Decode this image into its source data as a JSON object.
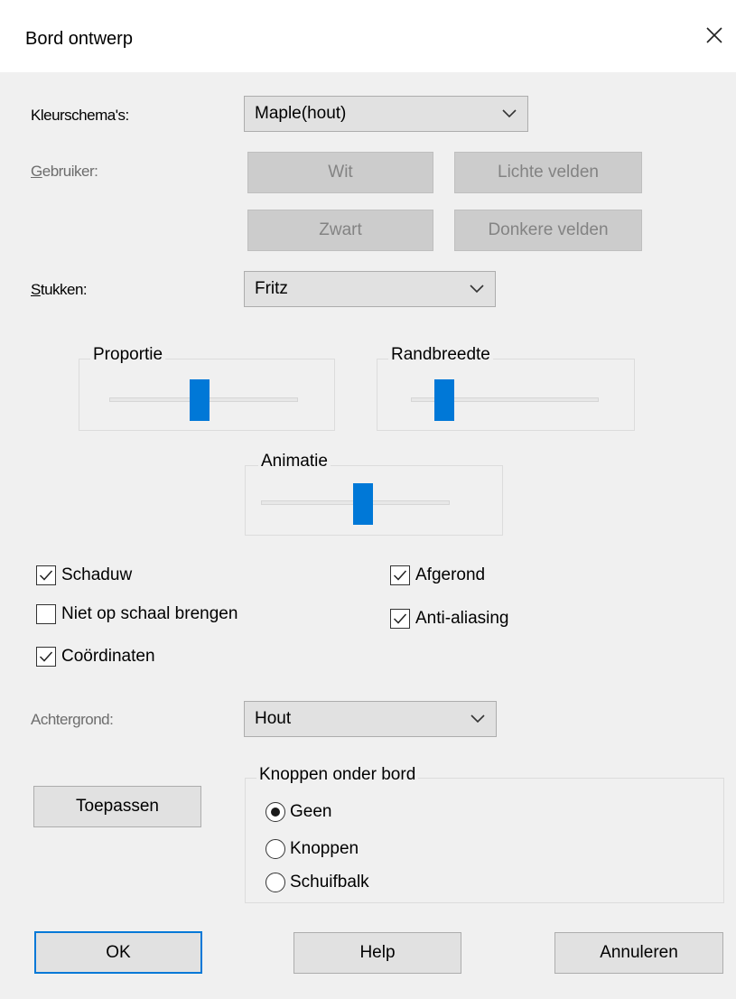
{
  "window": {
    "title": "Bord ontwerp"
  },
  "labels": {
    "color_schemes": "Kleurschema's:",
    "user_prefix": "G",
    "user_rest": "ebruiker:",
    "pieces_prefix": "S",
    "pieces_rest": "tukken:",
    "background": "Achtergrond:"
  },
  "combos": {
    "color_scheme": "Maple(hout)",
    "pieces": "Fritz",
    "background": "Hout"
  },
  "user_buttons": {
    "white": "Wit",
    "light_squares": "Lichte velden",
    "black": "Zwart",
    "dark_squares": "Donkere velden"
  },
  "sliders": {
    "proportion": {
      "label": "Proportie",
      "value_fraction": 0.48
    },
    "border_width": {
      "label": "Randbreedte",
      "value_fraction": 0.18
    },
    "animation": {
      "label": "Animatie",
      "value_fraction": 0.54
    }
  },
  "checkboxes": {
    "shadow": {
      "label": "Schaduw",
      "checked": true
    },
    "no_scale": {
      "label": "Niet op schaal brengen",
      "checked": false
    },
    "coordinates": {
      "label": "Coördinaten",
      "checked": true
    },
    "rounded": {
      "label": "Afgerond",
      "checked": true
    },
    "antialiasing": {
      "label": "Anti-aliasing",
      "checked": true
    }
  },
  "apply_button": "Toepassen",
  "buttons_group": {
    "title": "Knoppen onder bord",
    "options": [
      "Geen",
      "Knoppen",
      "Schuifbalk"
    ],
    "selected": "Geen"
  },
  "footer": {
    "ok": "OK",
    "help": "Help",
    "cancel": "Annuleren"
  },
  "colors": {
    "accent": "#0078d7",
    "dialog_bg": "#f0f0f0"
  }
}
